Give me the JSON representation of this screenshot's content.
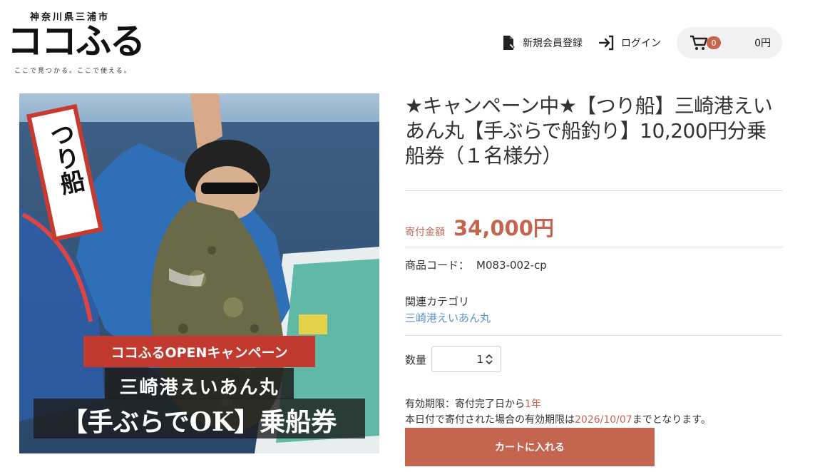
{
  "header": {
    "logo_prefecture": "神奈川県三浦市",
    "logo_name": "ココふる",
    "logo_tagline": "ここで見つかる。ここで使える。",
    "register_label": "新規会員登録",
    "login_label": "ログイン",
    "cart_count": "0",
    "cart_total": "0円"
  },
  "product": {
    "title": "★キャンペーン中★【つり船】三崎港えいあん丸【手ぶらで船釣り】10,200円分乗船券（１名様分）",
    "price_label": "寄付金額",
    "price_value": "34,000円",
    "code_label": "商品コード：",
    "code_value": "M083-002-cp",
    "category_label": "関連カテゴリ",
    "category_link": "三崎港えいあん丸",
    "quantity_label": "数量",
    "quantity_value": "1",
    "expiry_line1_prefix": "有効期限：寄付完了日から",
    "expiry_line1_value": "1年",
    "expiry_line2_prefix": "本日付で寄付された場合の有効期限は",
    "expiry_line2_date": "2026/10/07",
    "expiry_line2_suffix": "までとなります。",
    "add_to_cart_label": "カートに入れる"
  },
  "image": {
    "badge_text": "つり船",
    "campaign_text": "ココふるOPENキャンペーン",
    "boat_name": "三崎港えいあん丸",
    "ticket_text": "【手ぶらでOK】乗船券"
  },
  "colors": {
    "accent": "#c4654f",
    "link": "#5a94c8"
  }
}
